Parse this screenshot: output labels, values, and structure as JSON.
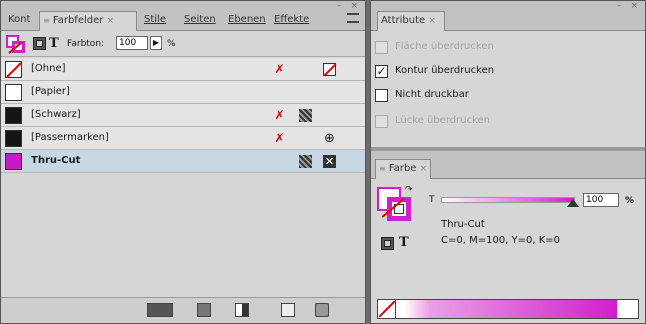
{
  "left": {
    "tabs": [
      {
        "label": "Kont",
        "close": ""
      },
      {
        "label": "Farbfelder",
        "close": "×"
      },
      {
        "label": "Stile",
        "close": ""
      },
      {
        "label": "Seiten",
        "close": ""
      },
      {
        "label": "Ebenen",
        "close": ""
      },
      {
        "label": "Effekte",
        "close": ""
      }
    ],
    "tab_visible": [
      "Kont",
      "Farbfelder ×",
      "Stile",
      "Seiten",
      "Ebenen",
      "Effekte"
    ],
    "win_controls": "– ×",
    "toolbar": {
      "t_label": "T",
      "tint_label": "Farbton:",
      "tint_value": "100",
      "percent": "%"
    },
    "swatches": [
      {
        "name": "[Ohne]",
        "chip_color": "#ffffff",
        "selected": false
      },
      {
        "name": "[Papier]",
        "chip_color": "#ffffff",
        "selected": false
      },
      {
        "name": "[Schwarz]",
        "chip_color": "#151515",
        "selected": false
      },
      {
        "name": "[Passermarken]",
        "chip_color": "#151515",
        "selected": false
      },
      {
        "name": "Thru-Cut",
        "chip_color": "#c61ac2",
        "selected": true
      }
    ]
  },
  "right": {
    "attr_tab": "Attribute",
    "attr_close": "×",
    "win_controls": "– ×",
    "attributes": [
      {
        "label": "Fläche überdrucken",
        "checked": false,
        "enabled": false
      },
      {
        "label": "Kontur überdrucken",
        "checked": true,
        "enabled": true
      },
      {
        "label": "Nicht druckbar",
        "checked": false,
        "enabled": true
      },
      {
        "label": "Lücke überdrucken",
        "checked": false,
        "enabled": false
      }
    ],
    "color_tab": "Farbe",
    "color_close": "×",
    "color": {
      "t_label": "T",
      "tint_value": "100",
      "percent": "%",
      "swatch_name": "Thru-Cut",
      "cmyk": "C=0, M=100, Y=0, K=0",
      "t_label2": "T",
      "accent": "#d21ecc"
    }
  }
}
